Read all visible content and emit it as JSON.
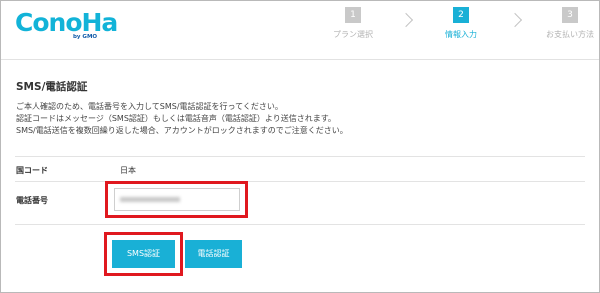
{
  "header": {
    "logo_text": "ConoHa",
    "logo_sub": "by GMO",
    "steps": [
      {
        "num": "1",
        "label": "プラン選択"
      },
      {
        "num": "2",
        "label": "情報入力"
      },
      {
        "num": "3",
        "label": "お支払い方法"
      }
    ],
    "active_step": 2,
    "accent_color": "#19b0d6"
  },
  "main": {
    "title": "SMS/電話認証",
    "description": [
      "ご本人確認のため、電話番号を入力してSMS/電話認証を行ってください。",
      "認証コードはメッセージ（SMS認証）もしくは電話音声（電話認証）より送信されます。",
      "SMS/電話送信を複数回繰り返した場合、アカウントがロックされますのでご注意ください。"
    ],
    "country_label": "国コード",
    "country_value": "日本",
    "phone_label": "電話番号",
    "phone_value": "",
    "sms_button": "SMS認証",
    "tel_button": "電話認証",
    "highlight_color": "#e0181f"
  }
}
